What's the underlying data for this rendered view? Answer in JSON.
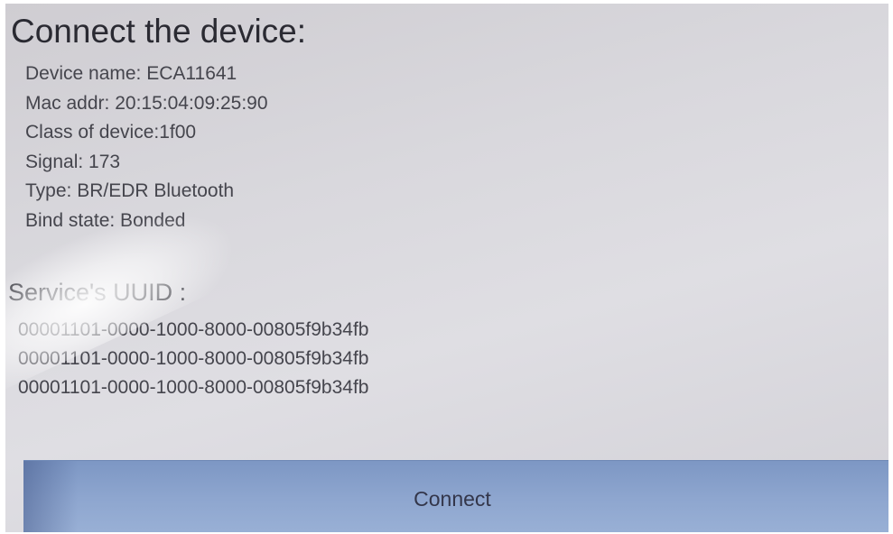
{
  "title": "Connect the device:",
  "device": {
    "name_line": "Device name: ECA11641",
    "mac_line": "Mac addr: 20:15:04:09:25:90",
    "class_line": "Class of device:1f00",
    "signal_line": "Signal: 173",
    "type_line": "Type: BR/EDR Bluetooth",
    "bind_line": "Bind state: Bonded"
  },
  "services": {
    "title": "Service's UUID :",
    "uuids": [
      "00001101-0000-1000-8000-00805f9b34fb",
      "00001101-0000-1000-8000-00805f9b34fb",
      "00001101-0000-1000-8000-00805f9b34fb"
    ]
  },
  "connect_button": {
    "label": "Connect"
  },
  "colors": {
    "screen_background": "#d9d8dd",
    "button_background": "#8ea6cf",
    "text": "#45454d"
  }
}
